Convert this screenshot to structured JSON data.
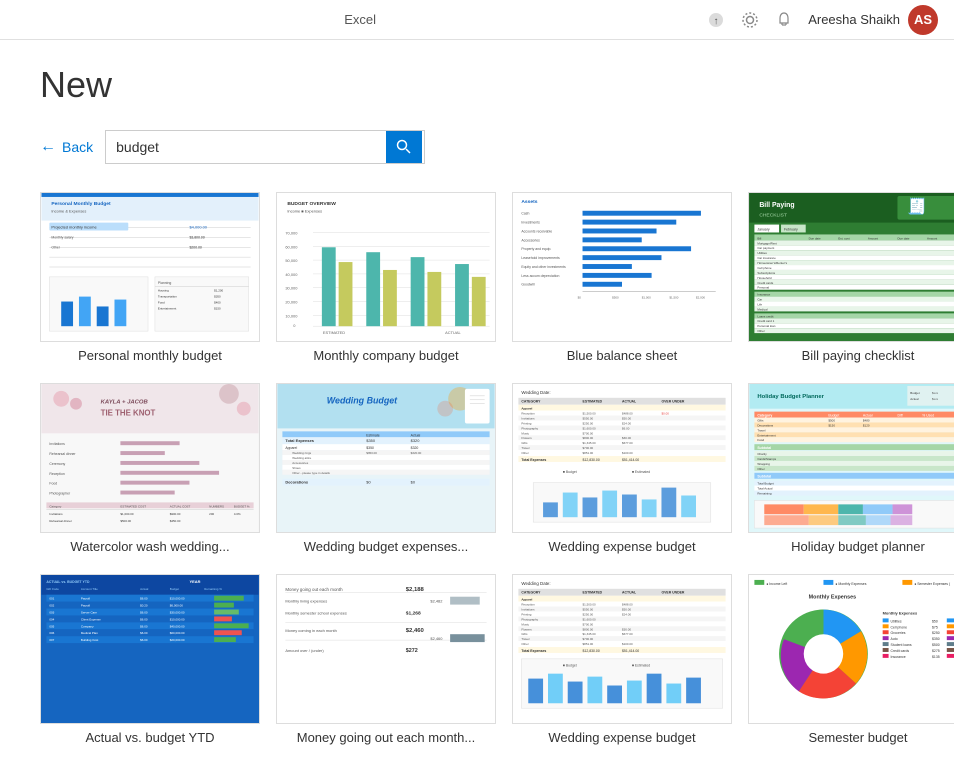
{
  "topbar": {
    "app_name": "Excel",
    "user_name": "Areesha Shaikh",
    "user_initials": "AS"
  },
  "page": {
    "title": "New",
    "back_label": "Back",
    "search_placeholder": "budget",
    "search_value": "budget"
  },
  "templates": [
    {
      "id": "personal-monthly-budget",
      "label": "Personal monthly budget",
      "row": 1
    },
    {
      "id": "monthly-company-budget",
      "label": "Monthly company budget",
      "row": 1
    },
    {
      "id": "blue-balance-sheet",
      "label": "Blue balance sheet",
      "row": 1
    },
    {
      "id": "bill-paying-checklist",
      "label": "Bill paying checklist",
      "row": 1
    },
    {
      "id": "watercolor-wash-wedding",
      "label": "Watercolor wash wedding...",
      "row": 2
    },
    {
      "id": "wedding-budget-expenses",
      "label": "Wedding budget expenses...",
      "row": 2
    },
    {
      "id": "wedding-expense-budget",
      "label": "Wedding expense budget",
      "row": 2
    },
    {
      "id": "holiday-budget-planner",
      "label": "Holiday budget planner",
      "row": 2
    },
    {
      "id": "actual-vs-budget",
      "label": "Actual vs. budget YTD",
      "row": 3
    },
    {
      "id": "monthly-going",
      "label": "Money going out each month...",
      "row": 3
    },
    {
      "id": "wedding3",
      "label": "Wedding expense budget",
      "row": 3
    },
    {
      "id": "semester-budget",
      "label": "Semester budget",
      "row": 3
    }
  ],
  "icons": {
    "search": "🔍",
    "back_arrow": "←",
    "settings": "⚙",
    "share": "↑",
    "minimize": "—"
  }
}
